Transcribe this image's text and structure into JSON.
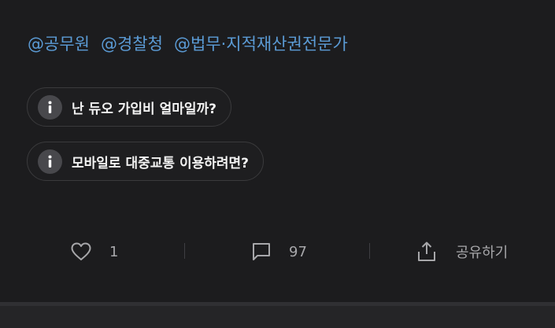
{
  "tags": [
    "@공무원",
    "@경찰청",
    "@법무·지적재산권전문가"
  ],
  "suggestions": [
    {
      "icon": "info-icon",
      "label": "난 듀오 가입비 얼마일까?"
    },
    {
      "icon": "info-icon",
      "label": "모바일로 대중교통 이용하려면?"
    }
  ],
  "actions": {
    "like": {
      "icon": "heart-icon",
      "count": "1"
    },
    "comment": {
      "icon": "comment-icon",
      "count": "97"
    },
    "share": {
      "icon": "share-icon",
      "label": "공유하기"
    }
  },
  "colors": {
    "background": "#1c1c1e",
    "tag": "#5b9bd5",
    "chip_border": "#3a3a3c",
    "muted_text": "#a7a7aa"
  }
}
